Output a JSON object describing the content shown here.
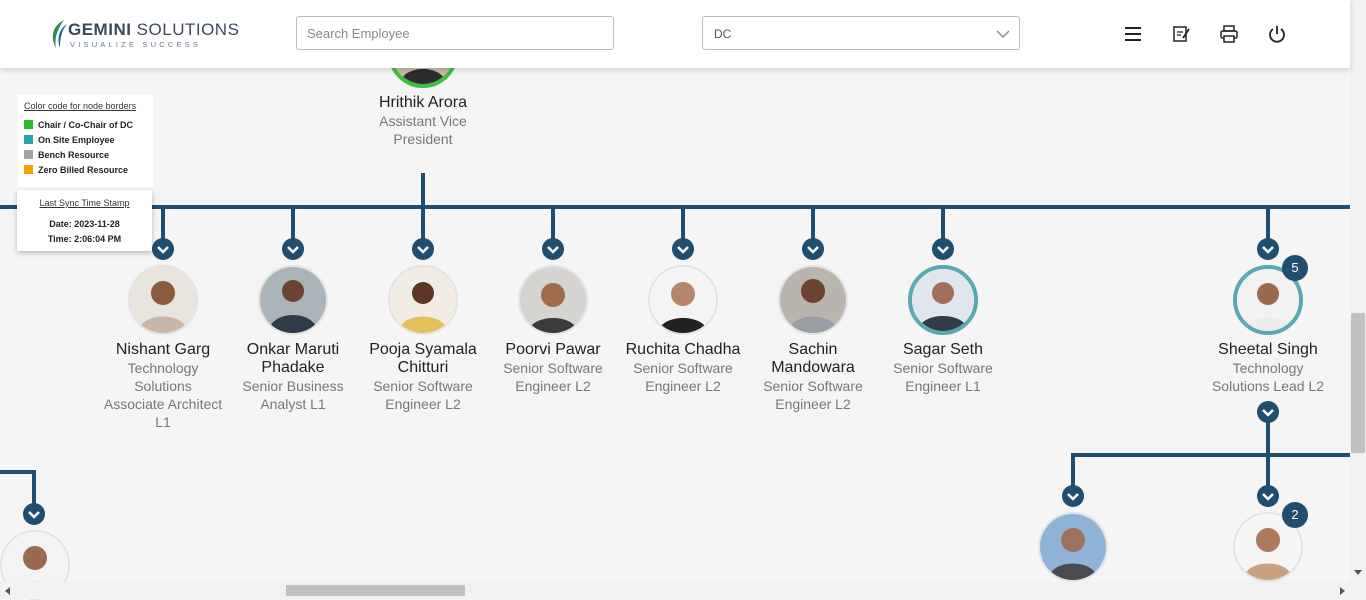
{
  "app": {
    "brand_bold": "GEMINI",
    "brand_rest": " SOLUTIONS",
    "tagline": "VISUALIZE SUCCESS"
  },
  "header": {
    "search_placeholder": "Search Employee",
    "department_value": "DC",
    "icons": [
      "menu-icon",
      "notes-icon",
      "print-icon",
      "power-icon"
    ]
  },
  "legend": {
    "title": "Color code for node borders",
    "items": [
      {
        "label": "Chair / Co-Chair of DC",
        "color": "#2db82d"
      },
      {
        "label": "On Site Employee",
        "color": "#2aa4a8"
      },
      {
        "label": "Bench Resource",
        "color": "#a5a5a5"
      },
      {
        "label": "Zero Billed Resource",
        "color": "#f5a300"
      }
    ]
  },
  "sync": {
    "title": "Last Sync Time Stamp",
    "date": "Date: 2023-11-28",
    "time": "Time: 2:06:04 PM"
  },
  "root": {
    "name": "Hrithik Arora",
    "title_line1": "Assistant Vice",
    "title_line2": "President"
  },
  "nodes": [
    {
      "name_lines": [
        "Nishant Garg"
      ],
      "title_lines": [
        "Technology",
        "Solutions",
        "Associate Architect",
        "L1"
      ]
    },
    {
      "name_lines": [
        "Onkar Maruti",
        "Phadake"
      ],
      "title_lines": [
        "Senior Business",
        "Analyst L1"
      ]
    },
    {
      "name_lines": [
        "Pooja Syamala",
        "Chitturi"
      ],
      "title_lines": [
        "Senior Software",
        "Engineer L2"
      ]
    },
    {
      "name_lines": [
        "Poorvi Pawar"
      ],
      "title_lines": [
        "Senior Software",
        "Engineer L2"
      ]
    },
    {
      "name_lines": [
        "Ruchita Chadha"
      ],
      "title_lines": [
        "Senior Software",
        "Engineer L2"
      ]
    },
    {
      "name_lines": [
        "Sachin",
        "Mandowara"
      ],
      "title_lines": [
        "Senior Software",
        "Engineer L2"
      ]
    },
    {
      "name_lines": [
        "Sagar Seth"
      ],
      "title_lines": [
        "Senior Software",
        "Engineer L1"
      ]
    },
    {
      "name_lines": [
        "Sheetal Singh"
      ],
      "title_lines": [
        "Technology",
        "Solutions Lead L2"
      ],
      "badge": "5"
    }
  ],
  "sub_badge": "2"
}
